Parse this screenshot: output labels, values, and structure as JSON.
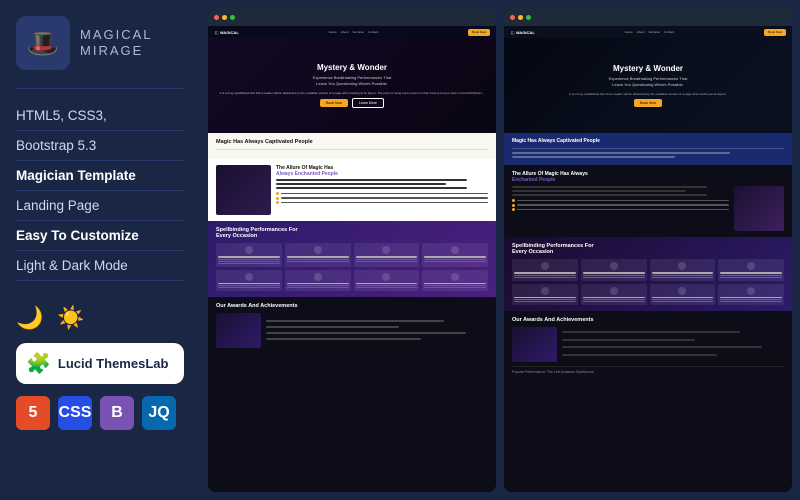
{
  "logo": {
    "icon": "🎩",
    "name": "MAGICAL",
    "tagline": "MIRAGE"
  },
  "features": [
    {
      "label": "HTML5, CSS3,",
      "highlight": false
    },
    {
      "label": "Bootstrap 5.3",
      "highlight": false
    },
    {
      "label": "Magician Template",
      "highlight": true
    },
    {
      "label": "Landing Page",
      "highlight": false
    },
    {
      "label": "Easy To Customize",
      "highlight": true
    },
    {
      "label": "Light & Dark Mode",
      "highlight": false
    }
  ],
  "theme_toggles": {
    "dark": "🌙",
    "light": "☀️"
  },
  "brand": {
    "icon": "🧩",
    "text": "Lucid ThemesLab"
  },
  "tech_badges": [
    {
      "label": "5",
      "type": "html",
      "icon": "H"
    },
    {
      "label": "CSS",
      "type": "css",
      "icon": "C"
    },
    {
      "label": "B",
      "type": "bs",
      "icon": "B"
    },
    {
      "label": "JQ",
      "type": "jq",
      "icon": "J"
    }
  ],
  "preview1": {
    "hero_title": "Mystery & Wonder",
    "hero_subtitle": "Experience Breathtaking Performances That\nLeave You Questioning What's Possible.",
    "hero_button": "Book Now",
    "section1_title": "Magic Has Always Captivated People",
    "section2_title_part1": "The Allure Of Magic Has",
    "section2_title_part2": "Always Enchanted People",
    "section3_title": "Spellbinding Performances For\nEvery Occasion",
    "section4_title": "Our Awards And\nAchievements"
  },
  "preview2": {
    "hero_title": "Mystery & Wonder",
    "hero_subtitle": "Experience Breathtaking Performances That\nLeave You Questioning What's Possible.",
    "section1_title": "Magic Has Always Captivated People",
    "section2_title_part1": "The Allure Of Magic Has Always",
    "section2_title_part2": "Enchanted People",
    "section3_title": "Spellbinding Performances For\nEvery Occasion",
    "section4_title": "Our Awards And\nAchievements",
    "footer_note": "Popular Performance: The Left Audience Spellbound"
  }
}
